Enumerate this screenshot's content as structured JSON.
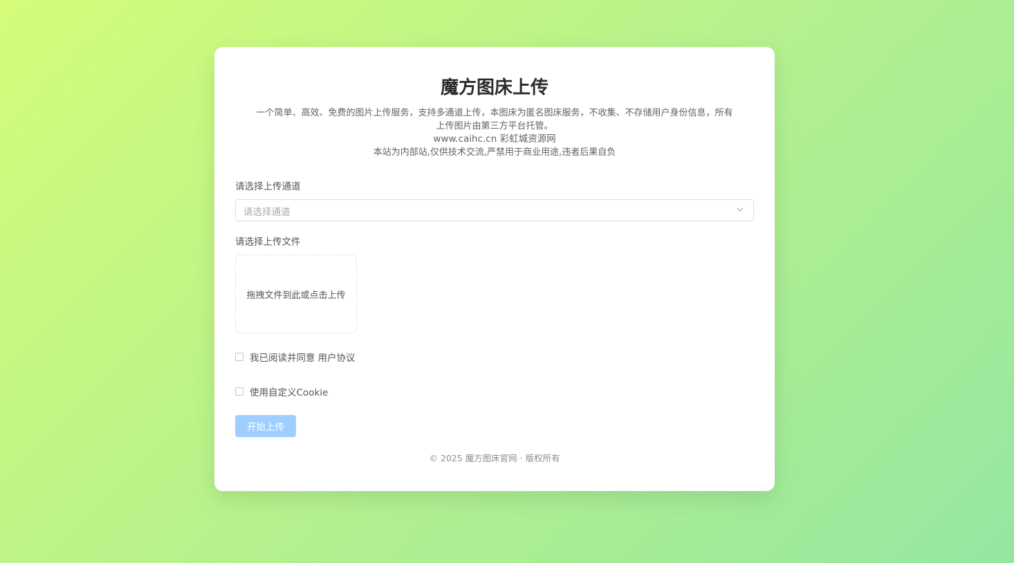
{
  "header": {
    "title": "魔方图床上传",
    "description_line1": "一个简单、高效、免费的图片上传服务，支持多通道上传，本图床为匿名图床服务，不收集、不存储用户身份信息，所有",
    "description_line2": "上传图片由第三方平台托管。",
    "site_line": "www.caihc.cn 彩虹城资源网",
    "notice": "本站为内部站,仅供技术交流,严禁用于商业用途,违者后果自负"
  },
  "channel": {
    "label": "请选择上传通道",
    "placeholder": "请选择通道",
    "icon": "chevron-down-icon"
  },
  "file": {
    "label": "请选择上传文件",
    "dropzone_text": "拖拽文件到此或点击上传"
  },
  "agreement": {
    "text": "我已阅读并同意",
    "link": "用户协议",
    "checked": false
  },
  "cookie": {
    "text": "使用自定义Cookie",
    "checked": false
  },
  "upload_button": {
    "label": "开始上传",
    "color": "#a0cfff"
  },
  "footer": {
    "copyright": "© 2025 魔方图床官网 · 版权所有"
  }
}
